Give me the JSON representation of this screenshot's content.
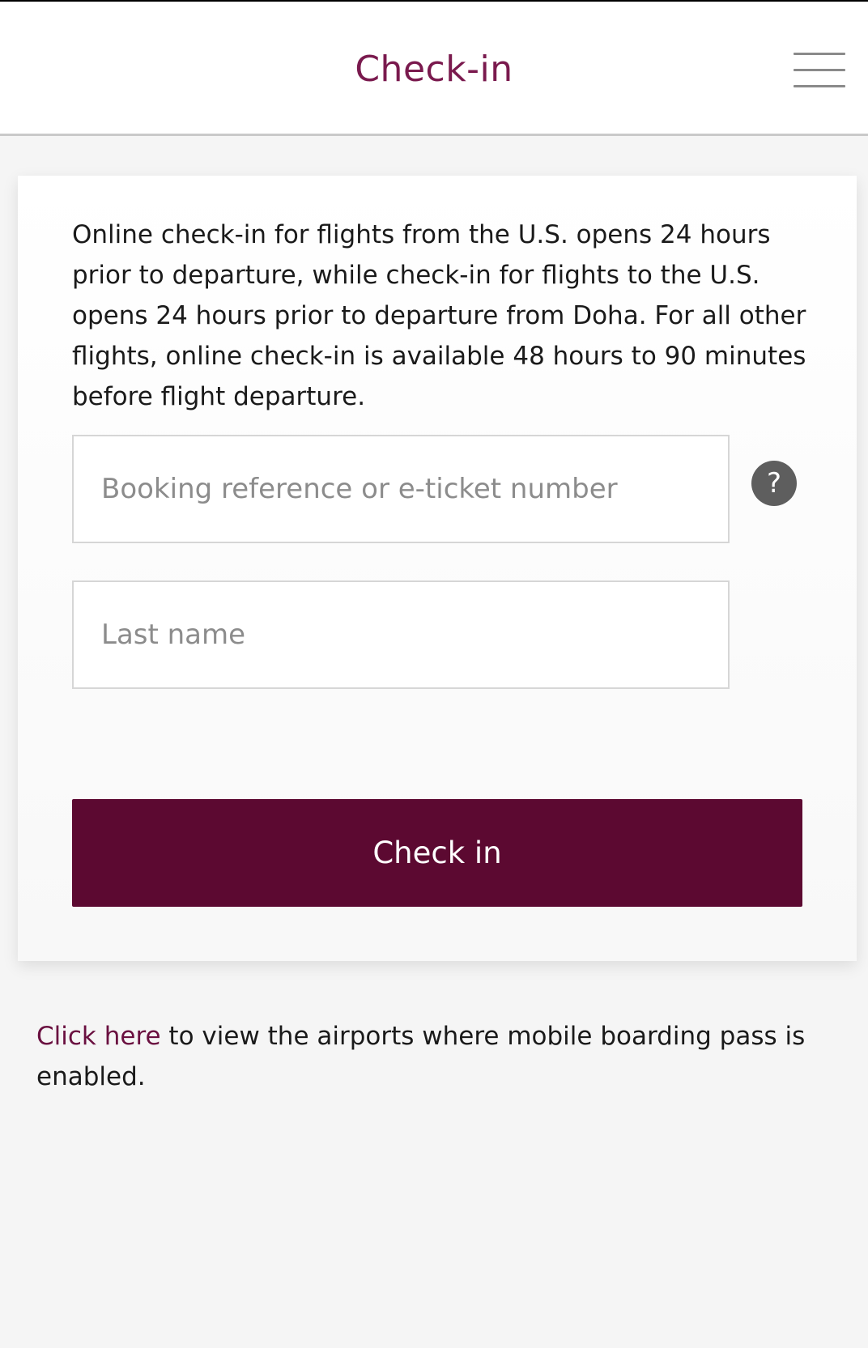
{
  "header": {
    "title": "Check-in",
    "menu_icon": "hamburger-menu-icon"
  },
  "checkin_form": {
    "intro_text": "Online check-in for flights from the U.S. opens 24 hours prior to departure, while check-in for flights to the U.S. opens 24 hours prior to departure from Doha. For all other flights, online check-in is available 48 hours to 90 minutes before flight departure.",
    "booking_field": {
      "placeholder": "Booking reference or e-ticket number",
      "value": ""
    },
    "help_icon": {
      "glyph": "?",
      "name": "question-mark-icon"
    },
    "lastname_field": {
      "placeholder": "Last name",
      "value": ""
    },
    "submit_label": "Check in"
  },
  "footer": {
    "link_text": "Click here",
    "rest_text": " to view the airports where mobile boarding pass is enabled."
  },
  "colors": {
    "brand": "#5c0931",
    "title": "#7a1a4e",
    "link": "#6a1040",
    "help_icon_bg": "#5e5e5e",
    "page_bg": "#f5f5f5"
  }
}
